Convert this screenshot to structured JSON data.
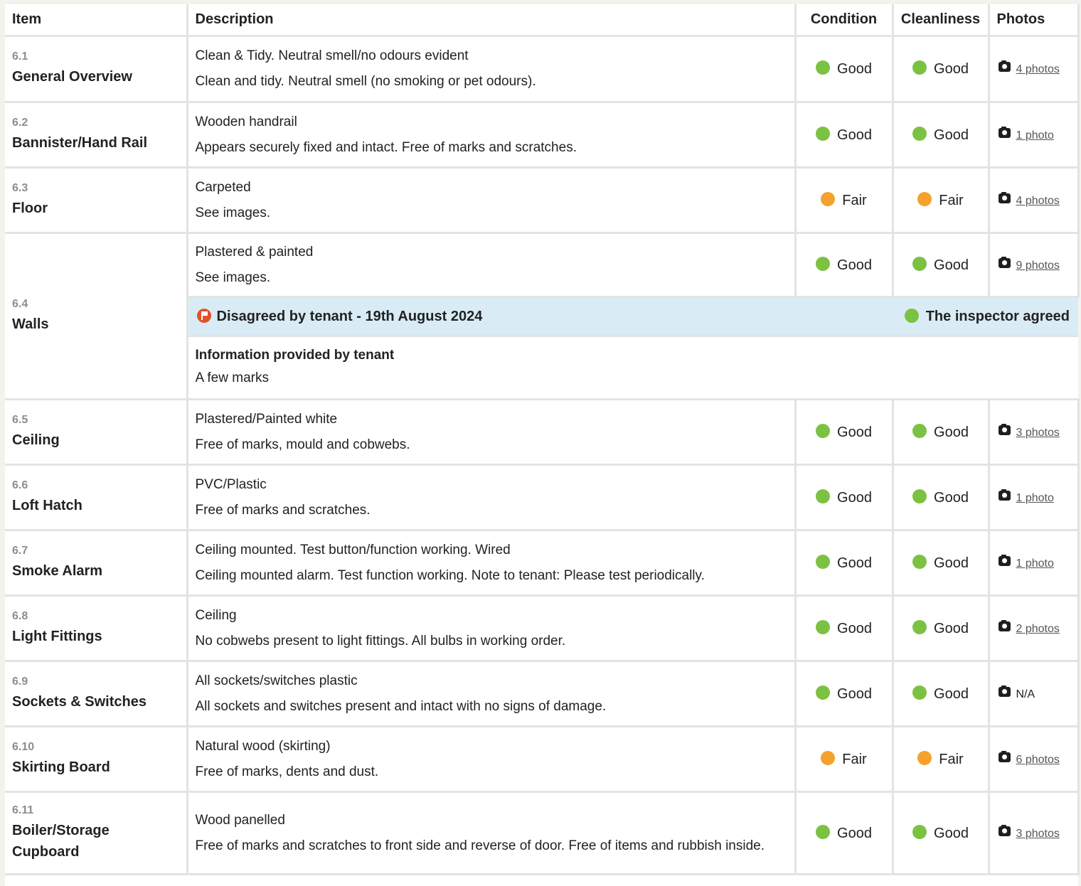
{
  "headers": {
    "item": "Item",
    "description": "Description",
    "condition": "Condition",
    "cleanliness": "Cleanliness",
    "photos": "Photos"
  },
  "rows": [
    {
      "num": "6.1",
      "name": "General Overview",
      "desc1": "Clean & Tidy. Neutral smell/no odours evident",
      "desc2": "Clean and tidy. Neutral smell (no smoking or pet odours).",
      "condition": "Good",
      "cleanliness": "Good",
      "photos": "4 photos"
    },
    {
      "num": "6.2",
      "name": "Bannister/Hand Rail",
      "desc1": "Wooden handrail",
      "desc2": "Appears securely fixed and intact. Free of marks and scratches.",
      "condition": "Good",
      "cleanliness": "Good",
      "photos": "1 photo"
    },
    {
      "num": "6.3",
      "name": "Floor",
      "desc1": "Carpeted",
      "desc2": "See images.",
      "condition": "Fair",
      "cleanliness": "Fair",
      "photos": "4 photos"
    },
    {
      "num": "6.4",
      "name": "Walls",
      "desc1": "Plastered & painted",
      "desc2": "See images.",
      "condition": "Good",
      "cleanliness": "Good",
      "photos": "9 photos"
    },
    {
      "num": "6.5",
      "name": "Ceiling",
      "desc1": "Plastered/Painted white",
      "desc2": "Free of marks, mould and cobwebs.",
      "condition": "Good",
      "cleanliness": "Good",
      "photos": "3 photos"
    },
    {
      "num": "6.6",
      "name": "Loft Hatch",
      "desc1": "PVC/Plastic",
      "desc2": "Free of marks and scratches.",
      "condition": "Good",
      "cleanliness": "Good",
      "photos": "1 photo"
    },
    {
      "num": "6.7",
      "name": "Smoke Alarm",
      "desc1": "Ceiling mounted. Test button/function working. Wired",
      "desc2": "Ceiling mounted alarm. Test function working. Note to tenant: Please test periodically.",
      "condition": "Good",
      "cleanliness": "Good",
      "photos": "1 photo"
    },
    {
      "num": "6.8",
      "name": "Light Fittings",
      "desc1": "Ceiling",
      "desc2": "No cobwebs present to light fittings. All bulbs in working order.",
      "condition": "Good",
      "cleanliness": "Good",
      "photos": "2 photos"
    },
    {
      "num": "6.9",
      "name": "Sockets & Switches",
      "desc1": "All sockets/switches plastic",
      "desc2": "All sockets and switches present and intact with no signs of damage.",
      "condition": "Good",
      "cleanliness": "Good",
      "photos": "N/A"
    },
    {
      "num": "6.10",
      "name": "Skirting Board",
      "desc1": "Natural wood (skirting)",
      "desc2": "Free of marks, dents and dust.",
      "condition": "Fair",
      "cleanliness": "Fair",
      "photos": "6 photos"
    },
    {
      "num": "6.11",
      "name": "Boiler/Storage Cupboard",
      "desc1": "Wood panelled",
      "desc2": "Free of marks and scratches to front side and reverse of door. Free of items and rubbish inside.",
      "condition": "Good",
      "cleanliness": "Good",
      "photos": "3 photos"
    }
  ],
  "dispute": {
    "disagreed_label": "Disagreed by tenant",
    "separator": " - ",
    "date": "19th August 2024",
    "status": "The inspector agreed",
    "info_title": "Information provided by tenant",
    "info_text": "A few marks"
  },
  "colors": {
    "good": "#7cc242",
    "fair": "#f4a22d",
    "dispute_bg": "#d9ecf5",
    "flag": "#e2512d"
  },
  "icons": {
    "photos": "camera-icon",
    "dispute": "flag-icon"
  }
}
